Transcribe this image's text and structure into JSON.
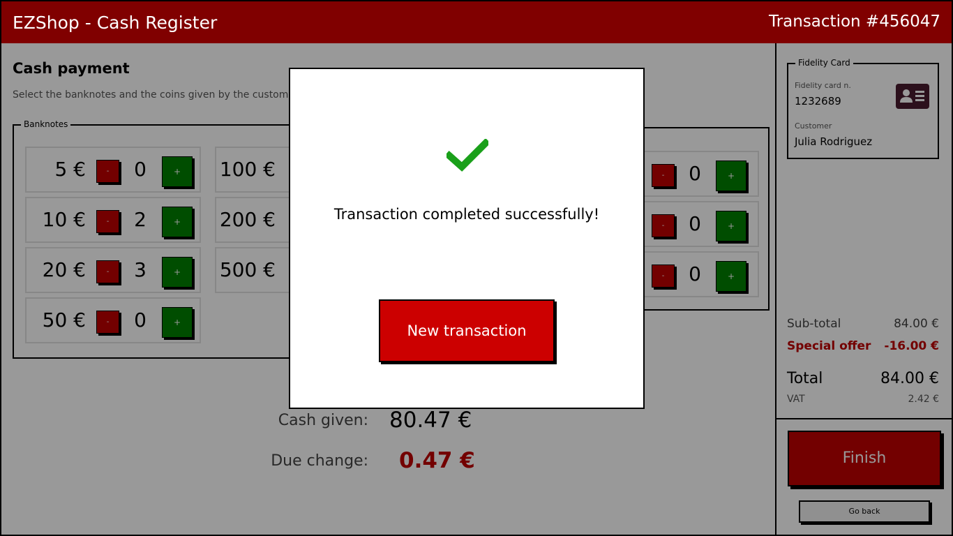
{
  "header": {
    "app_title": "EZShop - Cash Register",
    "transaction_number": "Transaction #456047"
  },
  "main": {
    "heading": "Cash payment",
    "instructions": "Select the banknotes and the coins given by the customer",
    "banknotes": {
      "legend": "Banknotes",
      "minus_label": "-",
      "plus_label": "+",
      "items": [
        {
          "value": "5 €",
          "count": "0"
        },
        {
          "value": "10 €",
          "count": "2"
        },
        {
          "value": "20 €",
          "count": "3"
        },
        {
          "value": "50 €",
          "count": "0"
        },
        {
          "value": "100 €",
          "count": ""
        },
        {
          "value": "200 €",
          "count": ""
        },
        {
          "value": "500 €",
          "count": ""
        }
      ]
    },
    "coins": {
      "items": [
        {
          "value": "",
          "count": "0"
        },
        {
          "value": "",
          "count": "0"
        },
        {
          "value": "",
          "count": "0"
        }
      ]
    },
    "cash_given": {
      "label": "Cash given:",
      "value": "80.47 €"
    },
    "due_change": {
      "label": "Due change:",
      "value": "0.47 €"
    }
  },
  "sidebar": {
    "fidelity": {
      "legend": "Fidelity Card",
      "card_label": "Fidelity card n.",
      "card_number": "1232689",
      "customer_label": "Customer",
      "customer_name": "Julia Rodriguez",
      "icon": "id-card-icon"
    },
    "summary": {
      "subtotal_label": "Sub-total",
      "subtotal_value": "84.00 €",
      "offer_label": "Special offer",
      "offer_value": "-16.00 €",
      "total_label": "Total",
      "total_value": "84.00 €",
      "vat_label": "VAT",
      "vat_value": "2.42 €"
    },
    "finish_label": "Finish",
    "back_label": "Go back"
  },
  "modal": {
    "icon": "check-icon",
    "message": "Transaction completed successfully!",
    "button_label": "New transaction"
  },
  "colors": {
    "header_bg": "#800000",
    "danger": "#c00000",
    "success": "#008000",
    "check": "#1aa01a"
  }
}
